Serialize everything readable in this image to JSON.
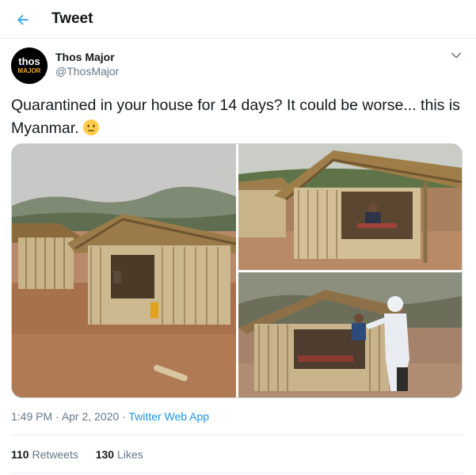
{
  "header": {
    "title": "Tweet",
    "back_icon": "arrow-left-icon"
  },
  "author": {
    "name": "Thos Major",
    "handle": "@ThosMajor",
    "avatar_text_top": "thos",
    "avatar_text_bottom": "MAJOR"
  },
  "tweet": {
    "text": "Quarantined in your house for 14 days? It could be worse... this is Myanmar.",
    "emoji": "neutral-face-emoji"
  },
  "media": {
    "count": 3,
    "photos": [
      "bamboo-huts-photo",
      "man-in-hut-photo",
      "hazmat-worker-photo"
    ]
  },
  "meta": {
    "time": "1:49 PM",
    "date": "Apr 2, 2020",
    "separator": " · ",
    "app": "Twitter Web App"
  },
  "stats": {
    "retweets_count": "110",
    "retweets_label": "Retweets",
    "likes_count": "130",
    "likes_label": "Likes"
  },
  "colors": {
    "accent": "#1da1f2",
    "secondary_text": "#657786",
    "link": "#1b95e0",
    "border": "#e6ecf0"
  }
}
